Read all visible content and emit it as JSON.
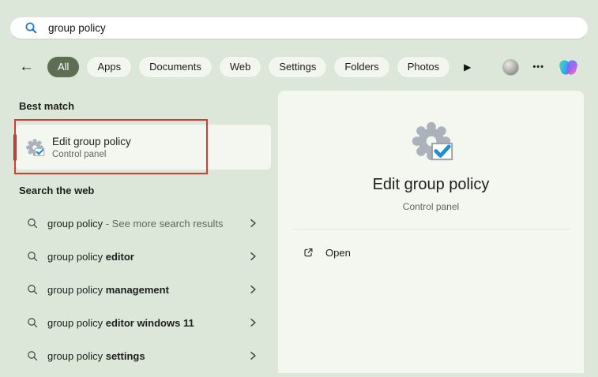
{
  "colors": {
    "background": "#dce7d9",
    "surface": "#f3f7f0",
    "tab_selected_bg": "#5d6e55",
    "tab_selected_text": "#ffffff",
    "text_primary": "#1c1e1b",
    "text_secondary": "#5f6761",
    "annotation_red": "#cf3e36",
    "selection_bar": "#7e403d",
    "search_icon_blue": "#2579c5",
    "check_blue": "#1e8fd5",
    "gear_gray": "#abb2bb"
  },
  "search": {
    "query": "group policy"
  },
  "topbar": {
    "back_icon": "←",
    "more_filters_icon": "▶",
    "ellipsis_icon": "•••",
    "tabs": [
      {
        "label": "All",
        "selected": true
      },
      {
        "label": "Apps",
        "selected": false
      },
      {
        "label": "Documents",
        "selected": false
      },
      {
        "label": "Web",
        "selected": false
      },
      {
        "label": "Settings",
        "selected": false
      },
      {
        "label": "Folders",
        "selected": false
      },
      {
        "label": "Photos",
        "selected": false
      }
    ]
  },
  "best_match": {
    "header": "Best match",
    "item": {
      "title": "Edit group policy",
      "subtitle": "Control panel"
    }
  },
  "web_search": {
    "header": "Search the web",
    "items": [
      {
        "text": "group policy",
        "bold": "",
        "suffix": " - See more search results"
      },
      {
        "text": "group policy",
        "bold": " editor",
        "suffix": ""
      },
      {
        "text": "group policy",
        "bold": " management",
        "suffix": ""
      },
      {
        "text": "group policy",
        "bold": " editor windows 11",
        "suffix": ""
      },
      {
        "text": "group policy",
        "bold": " settings",
        "suffix": ""
      }
    ]
  },
  "preview_panel": {
    "title": "Edit group policy",
    "subtitle": "Control panel",
    "open_label": "Open"
  },
  "annotation": {
    "shape": "red-rectangle",
    "target": "best-match-item"
  }
}
